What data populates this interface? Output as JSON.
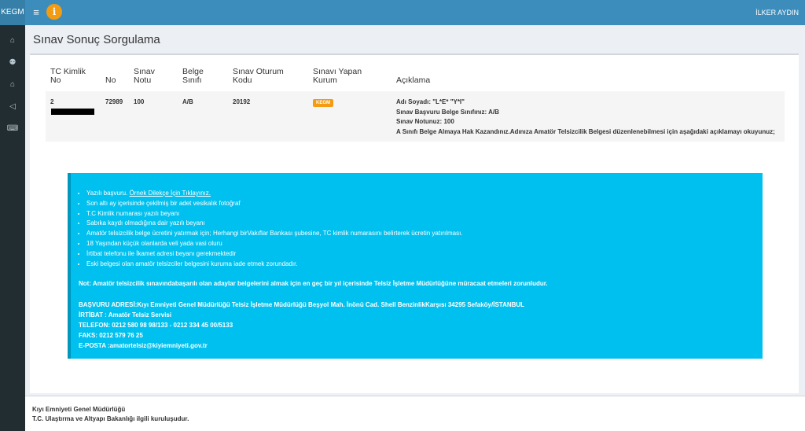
{
  "header": {
    "brand": "KEGM",
    "menu_icon": "≡",
    "info_icon": "i",
    "user": "İLKER AYDIN"
  },
  "sidebar": {
    "items": [
      {
        "name": "home",
        "glyph": "⌂"
      },
      {
        "name": "users",
        "glyph": "⚉"
      },
      {
        "name": "institution",
        "glyph": "⌂"
      },
      {
        "name": "volume",
        "glyph": "◁"
      },
      {
        "name": "keyboard",
        "glyph": "⌨"
      }
    ]
  },
  "page": {
    "title": "Sınav Sonuç Sorgulama"
  },
  "table": {
    "headers": {
      "tc": "TC Kimlik No",
      "no": "No",
      "score": "Sınav Notu",
      "cls": "Belge Sınıfı",
      "session": "Sınav Oturum Kodu",
      "inst": "Sınavı Yapan Kurum",
      "desc": "Açıklama"
    },
    "row": {
      "tc_prefix": "2",
      "no": "72989",
      "score": "100",
      "cls": "A/B",
      "session": "20192",
      "inst": "KEGM",
      "desc_line1": "Adı Soyadı: \"L*E* \"Y*I\"",
      "desc_line2": "Sınav Başvuru Belge Sınıfınız: A/B",
      "desc_line3": "Sınav Notunuz: 100",
      "desc_line4": "A Sınıfı Belge Almaya Hak Kazandınız.Adınıza Amatör Telsizcilik Belgesi düzenlenebilmesi için aşağıdaki açıklamayı okuyunuz;"
    }
  },
  "callout": {
    "item1_text": "Yazılı başvuru. ",
    "item1_link": "Örnek Dilekçe İçin Tıklayınız.",
    "item2": "Son altı ay içerisinde çekilmiş bir adet vesikalık fotoğraf",
    "item3": "T.C Kimlik numarası yazılı beyanı",
    "item4": "Sabıka kaydı olmadığına dair yazılı beyanı",
    "item5": "Amatör telsizcilik belge ücretini yatırmak için; Herhangi birVakıflar Bankası şubesine, TC kimlik numarasını belirterek ücretin yatırılması.",
    "item6": "18 Yaşından küçük olanlarda veli yada vasi oluru",
    "item7": "İrtibat telefonu ile İkamet adresi beyanı gerekmektedir",
    "item8": "Eski belgesi olan amatör telsizciler belgesini kuruma iade etmek zorundadır.",
    "note": "Not: Amatör telsizcilik sınavındabaşarılı olan adaylar belgelerini almak için en geç bir yıl içerisinde Telsiz İşletme Müdürlüğüne müracaat etmeleri zorunludur.",
    "addr1": "BAŞVURU ADRESİ:Kıyı Emniyeti Genel Müdürlüğü Telsiz İşletme Müdürlüğü Beşyol Mah. İnönü Cad. Shell BenzinlikKarşısı 34295 Sefaköy/İSTANBUL",
    "addr2": "İRTİBAT : Amatör Telsiz Servisi",
    "addr3": "TELEFON: 0212 580 98 98/133 - 0212 334 45 00/5133",
    "addr4": "FAKS: 0212 579 76 25",
    "addr5": "E-POSTA :amatortelsiz@kiyiemniyeti.gov.tr"
  },
  "footer": {
    "line1": "Kıyı Emniyeti Genel Müdürlüğü",
    "line2": "T.C. Ulaştırma ve Altyapı Bakanlığı ilgili kuruluşudur."
  }
}
